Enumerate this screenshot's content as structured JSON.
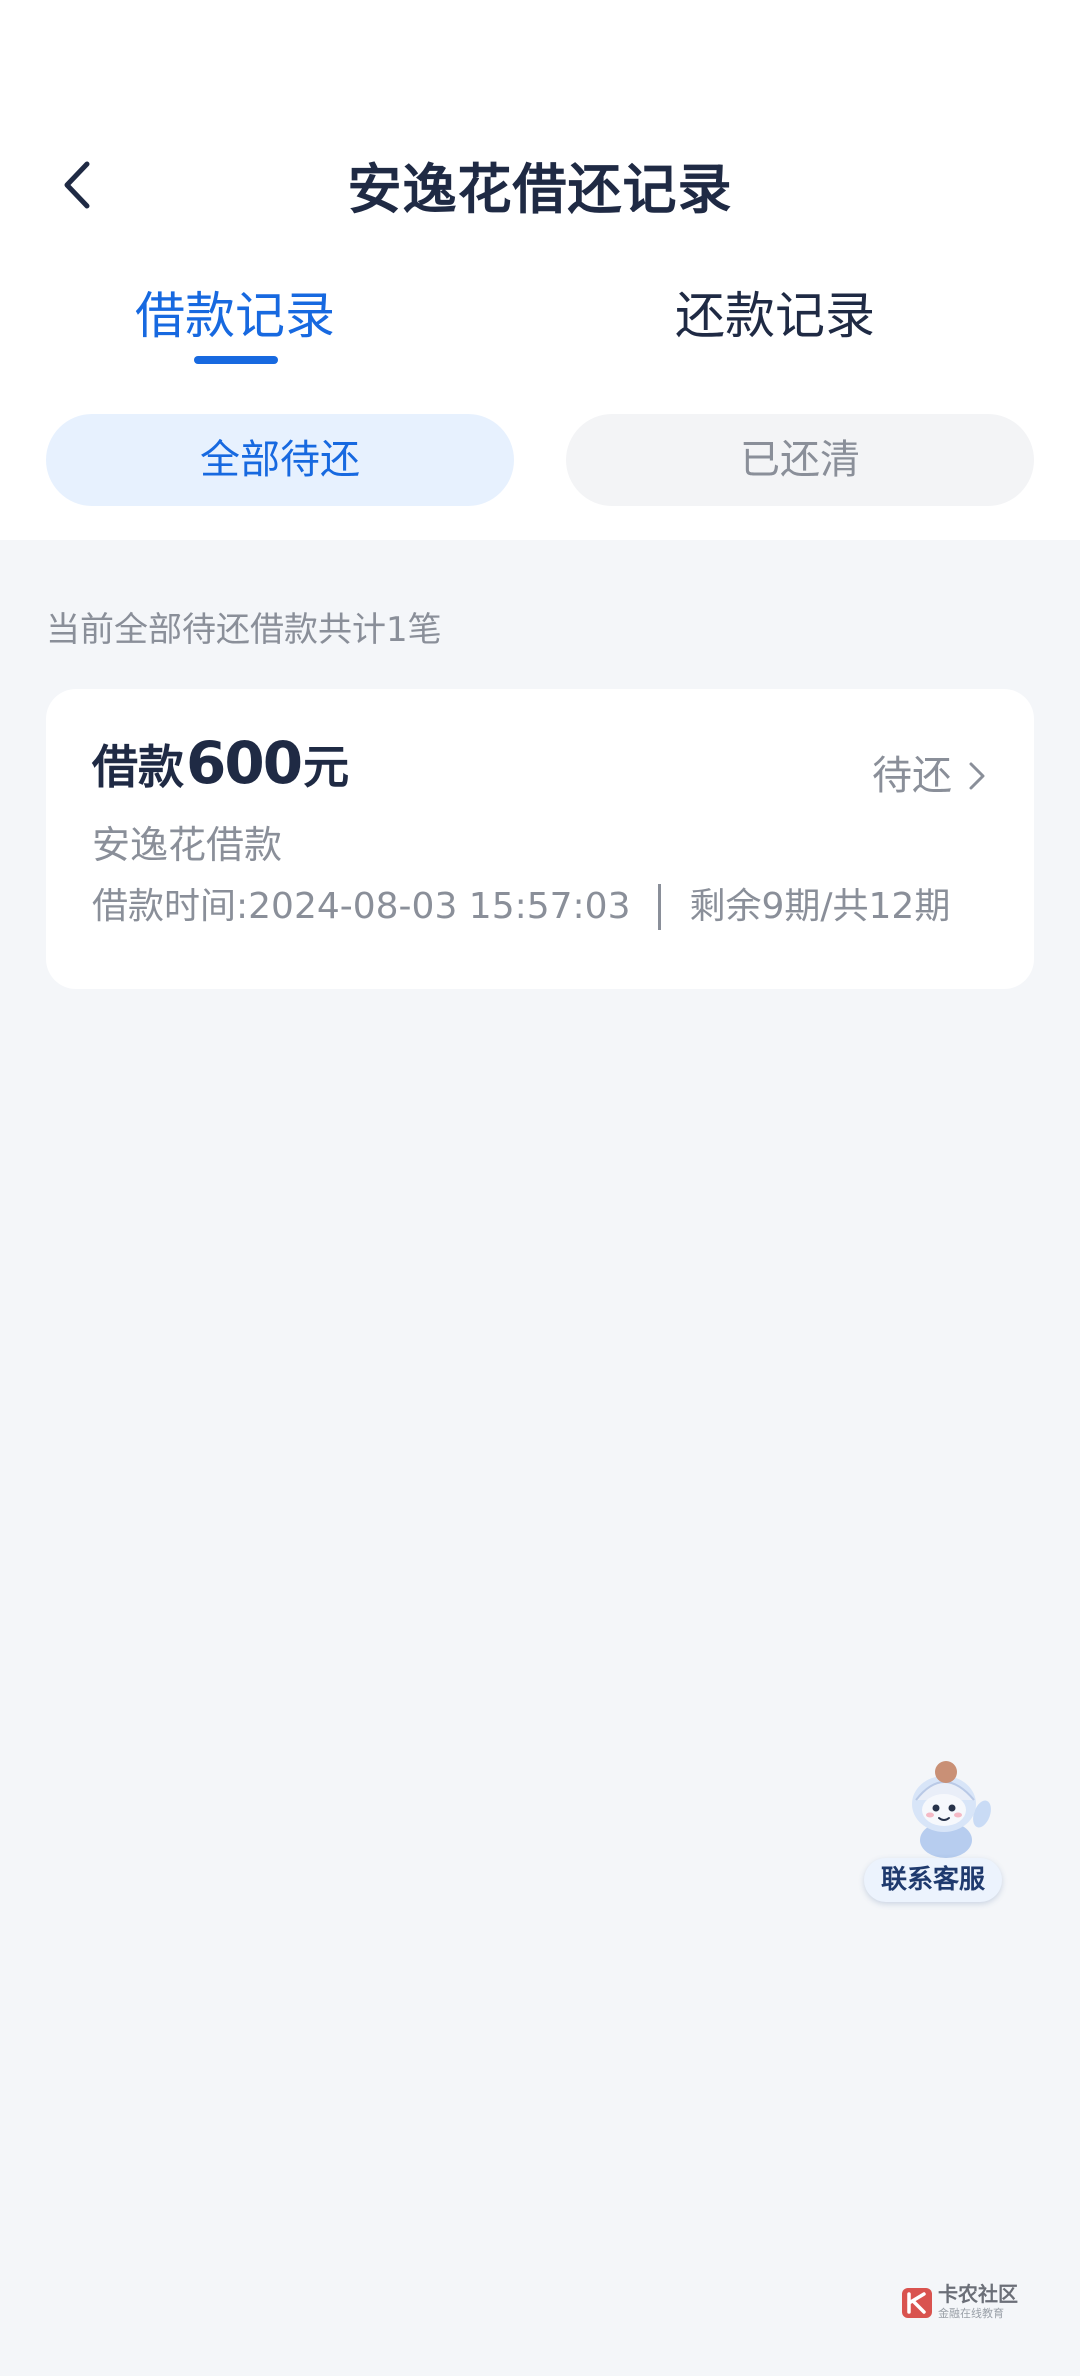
{
  "header": {
    "title": "安逸花借还记录",
    "back_icon": "chevron-left-icon"
  },
  "tabs": [
    {
      "label": "借款记录",
      "active": true
    },
    {
      "label": "还款记录",
      "active": false
    }
  ],
  "filters": [
    {
      "label": "全部待还",
      "selected": true
    },
    {
      "label": "已还清",
      "selected": false
    }
  ],
  "summary": "当前全部待还借款共计1笔",
  "loans": [
    {
      "amount_prefix": "借款",
      "amount": "600",
      "amount_unit": "元",
      "status": "待还",
      "product": "安逸花借款",
      "time": "借款时间:2024-08-03 15:57:03",
      "installments": "剩余9期/共12期"
    }
  ],
  "customer_service": {
    "label": "联系客服",
    "icon": "mascot-icon"
  },
  "watermark": {
    "title": "卡农社区",
    "subtitle": "金融在线教育"
  },
  "colors": {
    "accent": "#1769e0",
    "text_primary": "#1f2a44",
    "text_secondary": "#8a8f99",
    "background": "#f4f6f9"
  }
}
